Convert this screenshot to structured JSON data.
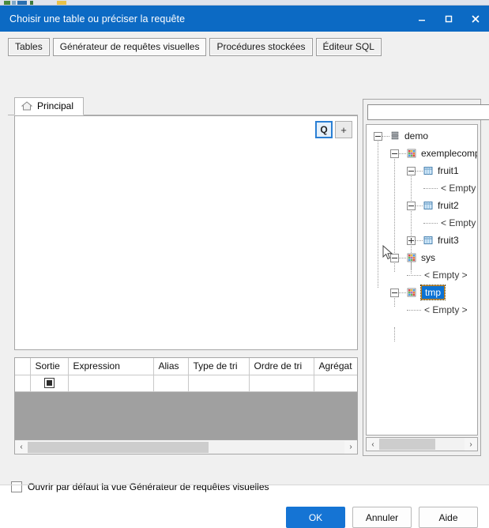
{
  "window": {
    "title": "Choisir une table ou préciser la requête",
    "controls": {
      "minimize": "minimize-icon",
      "maximize": "maximize-icon",
      "close": "close-icon"
    }
  },
  "tabs": [
    {
      "label": "Tables",
      "active": false
    },
    {
      "label": "Générateur de requêtes visuelles",
      "active": true
    },
    {
      "label": "Procédures stockées",
      "active": false
    },
    {
      "label": "Éditeur SQL",
      "active": false
    }
  ],
  "subtab": {
    "label": "Principal",
    "icon": "home-icon"
  },
  "canvas": {
    "tools": [
      {
        "label": "Q",
        "name": "query-tool-button",
        "selected": true
      },
      {
        "label": "+",
        "name": "add-tool-button",
        "selected": false
      }
    ]
  },
  "grid": {
    "columns": [
      "Sortie",
      "Expression",
      "Alias",
      "Type de tri",
      "Ordre de tri",
      "Agrégat"
    ],
    "rows": [
      {
        "sortie": "",
        "expression": "",
        "alias": "",
        "type_de_tri": "",
        "ordre_de_tri": "",
        "agregat": ""
      }
    ]
  },
  "scrollbars": {
    "grid_h": {
      "left_arrow": "‹",
      "right_arrow": "›",
      "thumb_percent": 57
    },
    "tree_h": {
      "left_arrow": "‹",
      "right_arrow": "›",
      "thumb_percent": 66
    }
  },
  "tree_panel": {
    "search": {
      "value": "",
      "placeholder": ""
    },
    "clear_button": "✕",
    "nodes": [
      {
        "label": "demo",
        "icon": "database-icon",
        "depth": 0,
        "toggle": "minus"
      },
      {
        "label": "exemplecompareta",
        "icon": "schema-icon",
        "depth": 1,
        "toggle": "minus"
      },
      {
        "label": "fruit1",
        "icon": "table-icon",
        "depth": 2,
        "toggle": "minus"
      },
      {
        "label": "< Empty >",
        "icon": "none",
        "depth": 3,
        "toggle": "none"
      },
      {
        "label": "fruit2",
        "icon": "table-icon",
        "depth": 2,
        "toggle": "minus"
      },
      {
        "label": "< Empty >",
        "icon": "none",
        "depth": 3,
        "toggle": "none"
      },
      {
        "label": "fruit3",
        "icon": "table-icon",
        "depth": 2,
        "toggle": "plus"
      },
      {
        "label": "sys",
        "icon": "schema-icon",
        "depth": 1,
        "toggle": "minus"
      },
      {
        "label": "< Empty >",
        "icon": "none",
        "depth": 2,
        "toggle": "none"
      },
      {
        "label": "tmp",
        "icon": "schema-icon",
        "depth": 1,
        "toggle": "minus",
        "selected": true
      },
      {
        "label": "< Empty >",
        "icon": "none",
        "depth": 2,
        "toggle": "none"
      }
    ]
  },
  "options": {
    "default_view_checkbox": {
      "label": "Ouvrir par défaut la vue Générateur de requêtes visuelles",
      "checked": false
    }
  },
  "buttons": {
    "ok": "OK",
    "cancel": "Annuler",
    "help": "Aide"
  },
  "colors": {
    "title_bar": "#0c6ac4",
    "accent": "#1574d4",
    "selection": "#0b72d4",
    "dialog_bg": "#f0f0f0",
    "grid_empty": "#a0a0a0"
  }
}
